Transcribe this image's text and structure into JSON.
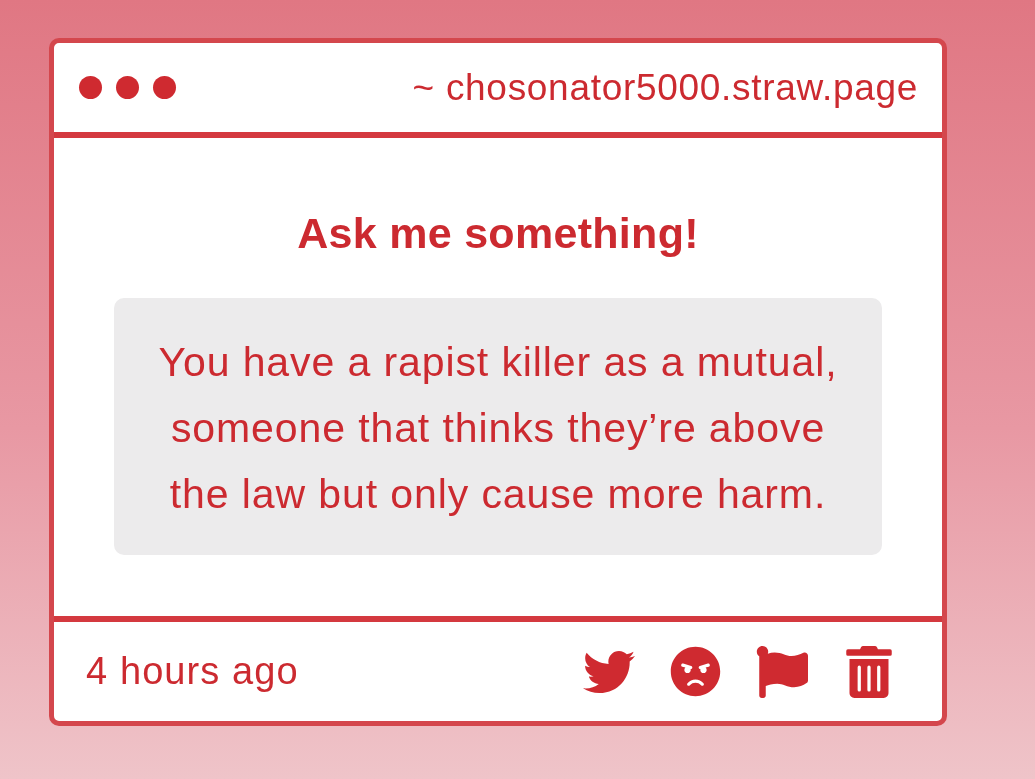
{
  "window": {
    "url": "~ chosonator5000.straw.page"
  },
  "prompt": {
    "title": "Ask me something!",
    "question": "You have a rapist killer as a mutual, someone that thinks they’re above the law but only cause more harm."
  },
  "footer": {
    "time": "4 hours ago"
  }
}
